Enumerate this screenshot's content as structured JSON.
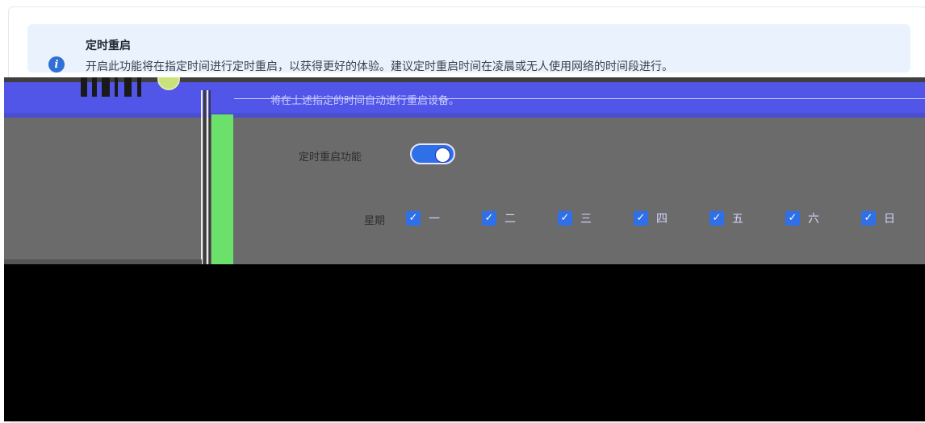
{
  "notice": {
    "title": "定时重启",
    "description": "开启此功能将在指定时间进行定时重启，以获得更好的体验。建议定时重启时间在凌晨或无人使用网络的时间段进行。"
  },
  "overlay": {
    "bar_text": "将在上述指定的时间自动进行重启设备。"
  },
  "form": {
    "enable_label": "定时重启功能",
    "enabled": true,
    "week_label": "星期",
    "days": [
      {
        "label": "一",
        "checked": true
      },
      {
        "label": "二",
        "checked": true
      },
      {
        "label": "三",
        "checked": true
      },
      {
        "label": "四",
        "checked": true
      },
      {
        "label": "五",
        "checked": true
      },
      {
        "label": "六",
        "checked": true
      },
      {
        "label": "日",
        "checked": true
      }
    ]
  },
  "colors": {
    "accent": "#2f6fe8",
    "notice_bg": "#eaf3fd",
    "overlay_bar": "#5156e8",
    "overlay_green": "#6be06a"
  }
}
